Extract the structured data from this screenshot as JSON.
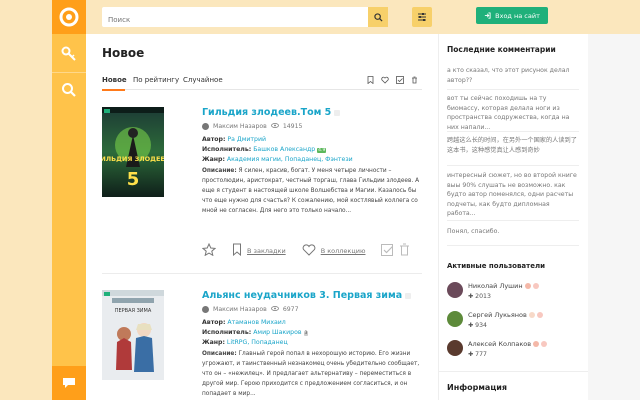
{
  "header": {
    "search_placeholder": "Поиск",
    "login_label": "Вход на сайт"
  },
  "main": {
    "title": "Новое",
    "tabs": [
      {
        "label": "Новое",
        "active": true
      },
      {
        "label": "По рейтингу",
        "active": false
      },
      {
        "label": "Случайное",
        "active": false
      }
    ]
  },
  "books": [
    {
      "title": "Гильдия злодеев.Том 5",
      "author_user": "Максим Назаров",
      "views": "14915",
      "author_label": "Автор:",
      "author": "Ра Дмитрий",
      "performer_label": "Исполнитель:",
      "performer": "Башков Александр",
      "performer_badge": "4.9",
      "genre_label": "Жанр:",
      "genres": "Академия магии, Попаданец, Фэнтези",
      "desc_label": "Описание:",
      "desc": "Я силен, красив, богат. У меня четыре личности – простолюдин, аристократ, честный торгаш, глава Гильдии злодеев. А еще я студент в настоящей школе Волшебства и Магии. Казалось бы что еще нужно для счастья? К сожалению, мой костлявый коллега со мной не согласен. Для него это только начало...",
      "bookmark_label": "В закладки",
      "collection_label": "В коллекцию",
      "cover_top": "ГИЛЬДИЯ ЗЛОДЕЕВ",
      "cover_num": "5"
    },
    {
      "title": "Альянс неудачников 3. Первая зима",
      "author_user": "Максим Назаров",
      "views": "6977",
      "author_label": "Автор:",
      "author": "Атаманов Михаил",
      "performer_label": "Исполнитель:",
      "performer": "Амир Шакиров",
      "performer_badge": "3",
      "genre_label": "Жанр:",
      "genres": "LitRPG, Попаданец",
      "desc_label": "Описание:",
      "desc": "Главный герой попал в нехорошую историю. Его жизни угрожают, и таинственный незнакомец очень убедительно сообщает, что он – «нежилец». И предлагает альтернативу – переместиться в другой мир. Герою приходится с предложением согласиться, и он попадает в мир...",
      "cover_top": "ПЕРВАЯ ЗИМА"
    }
  ],
  "sidebar": {
    "comments_title": "Последние комментарии",
    "comments": [
      "а кто сказал, что этот рисунок делал автор??",
      "вот ты сейчас походишь на ту биомассу, которая делала ноги из пространства содружества, когда на них напали...",
      "跨越这么长的时间，在另外一个国家的人读到了这本书，这种感觉真让人感到奇妙",
      "интересный сюжет, но во второй книге выы 90% слушать не возможно. как будто автор поменялся, одни расчеты подчеты, как будто дипломная работа...",
      "Понял, спасибо."
    ],
    "users_title": "Активные пользователи",
    "users": [
      {
        "name": "Николай Лушин",
        "points": "2013"
      },
      {
        "name": "Сергей Лукьянов",
        "points": "934"
      },
      {
        "name": "Алексей Колпаков",
        "points": "777"
      }
    ],
    "info_title": "Информация"
  },
  "colors": {
    "accent": "#ff9f1a",
    "link": "#1aa5c9",
    "login": "#1fb07a"
  }
}
